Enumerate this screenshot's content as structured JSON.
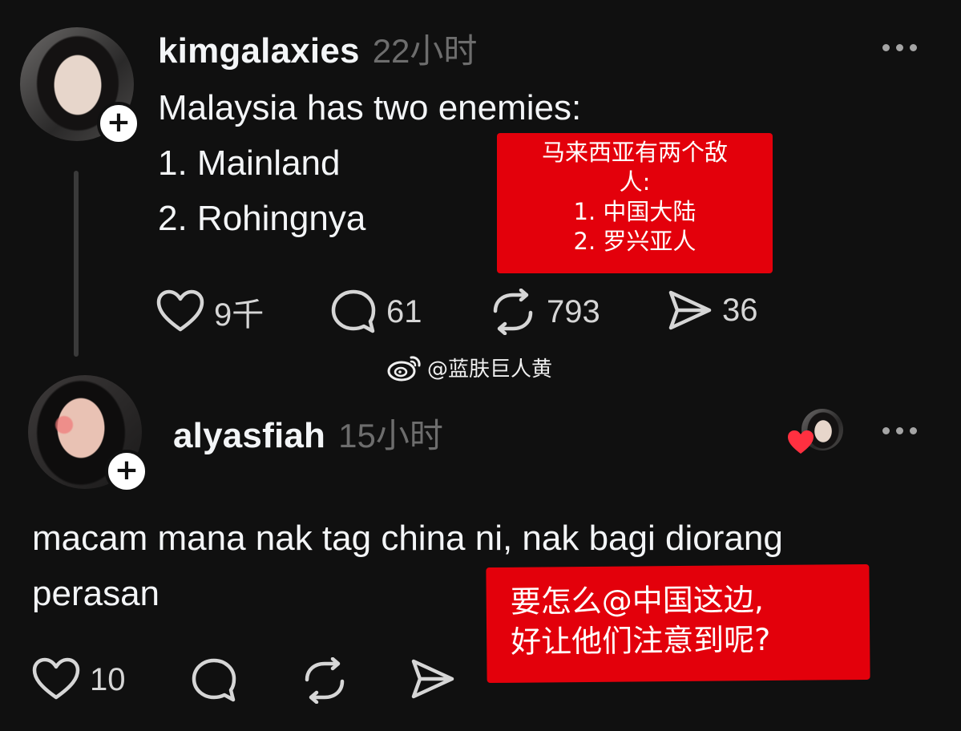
{
  "post": {
    "username": "kimgalaxies",
    "time": "22小时",
    "lines": [
      "Malaysia has two enemies:",
      "1. Mainland",
      "2. Rohingnya"
    ],
    "translation_lines": [
      "马来西亚有两个敌",
      "人:",
      "1. 中国大陆",
      "2. 罗兴亚人"
    ],
    "actions": {
      "likes": "9千",
      "replies": "61",
      "reposts": "793",
      "shares": "36"
    }
  },
  "watermark": {
    "text": "@蓝肤巨人黄",
    "icon": "weibo-icon"
  },
  "reply": {
    "username": "alyasfiah",
    "time": "15小时",
    "lines": [
      "macam mana nak tag china ni, nak bagi diorang",
      "perasan"
    ],
    "translation_lines": [
      "要怎么@中国这边,",
      "好让他们注意到呢?"
    ],
    "actions": {
      "likes": "10"
    }
  },
  "follow_symbol": "+",
  "colors": {
    "background": "#101010",
    "text": "#f3f5f7",
    "muted": "#6d6d6d",
    "overlay": "#e3000b",
    "heart": "#ff3040"
  }
}
